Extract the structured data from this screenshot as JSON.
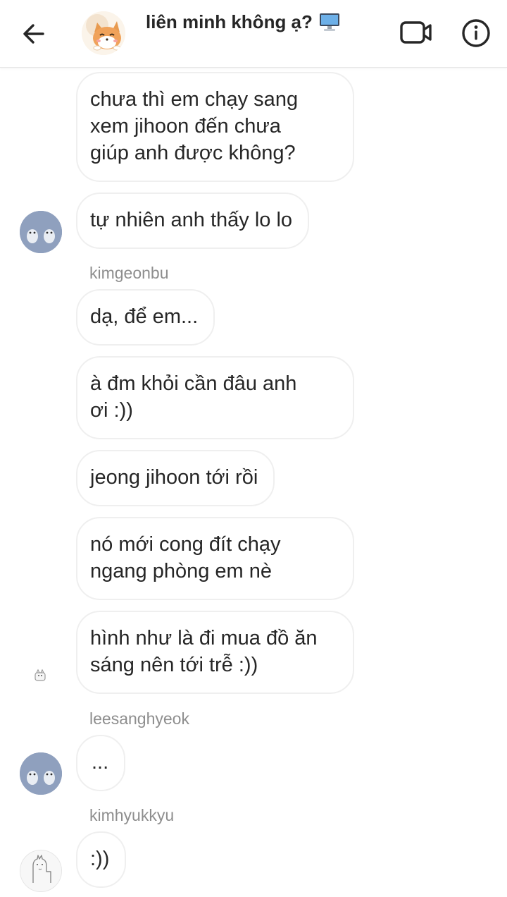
{
  "header": {
    "title": "liên minh không ạ?",
    "emoji_icon": "computer-monitor-icon"
  },
  "colors": {
    "bubble_border": "#efefef",
    "text": "#262626",
    "sender_text": "#8e8e8e",
    "avatar_penguin_bg": "#8fa0be"
  },
  "messages": [
    {
      "text": "chưa thì em chạy sang\nxem jihoon đến chưa\ngiúp anh được không?"
    },
    {
      "text": "tự nhiên anh thấy lo lo"
    },
    {
      "sender": "kimgeonbu"
    },
    {
      "text": "dạ, để em..."
    },
    {
      "text": "à đm khỏi cần đâu anh\nơi :))"
    },
    {
      "text": "jeong jihoon tới rồi"
    },
    {
      "text": "nó mới cong đít chạy\nngang phòng em nè"
    },
    {
      "text": "hình như là đi mua đồ ăn\nsáng nên tới trễ :))"
    },
    {
      "sender": "leesanghyeok"
    },
    {
      "text": "..."
    },
    {
      "sender": "kimhyukkyu"
    },
    {
      "text": ":))"
    }
  ]
}
